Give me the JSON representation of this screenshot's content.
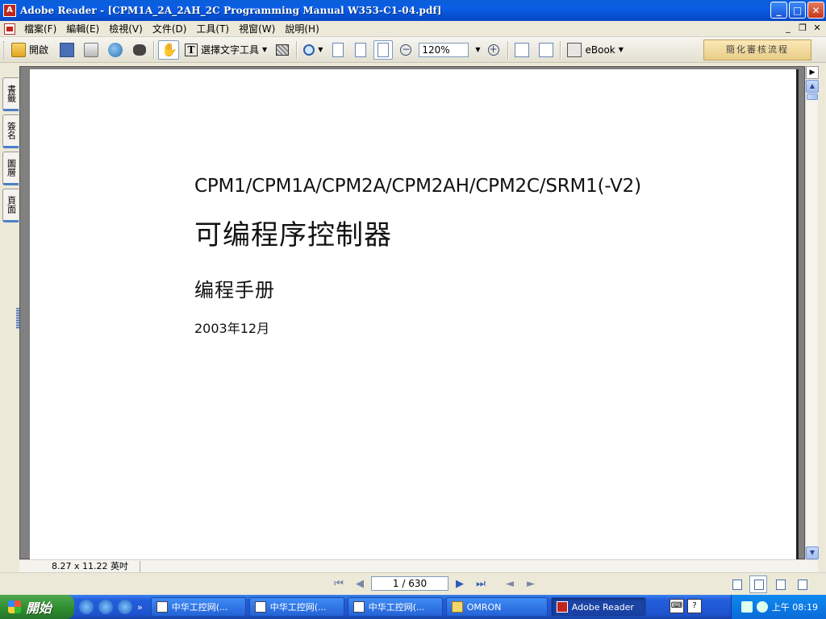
{
  "window": {
    "title": "Adobe Reader - [CPM1A_2A_2AH_2C Programming Manual W353-C1-04.pdf]",
    "app_icon": "pdf-icon"
  },
  "menu": {
    "items": [
      "檔案(F)",
      "編輯(E)",
      "檢視(V)",
      "文件(D)",
      "工具(T)",
      "視窗(W)",
      "說明(H)"
    ]
  },
  "toolbar": {
    "open_label": "開啟",
    "select_text_label": "選擇文字工具",
    "zoom_value": "120%",
    "ebook_label": "eBook",
    "workflow_label": "簡化審核流程"
  },
  "side_tabs": [
    "書籤",
    "簽名",
    "圖層",
    "頁面"
  ],
  "document": {
    "model_line": "CPM1/CPM1A/CPM2A/CPM2AH/CPM2C/SRM1(-V2)",
    "title": "可编程序控制器",
    "subtitle": "编程手册",
    "date": "2003年12月"
  },
  "status": {
    "page_size": "8.27 x 11.22 英吋",
    "page_indicator": "1 / 630"
  },
  "taskbar": {
    "start_label": "開始",
    "tasks": [
      {
        "label": "中华工控网(...",
        "icon": "browser-icon"
      },
      {
        "label": "中华工控网(...",
        "icon": "browser-icon"
      },
      {
        "label": "中华工控网(...",
        "icon": "browser-icon"
      },
      {
        "label": "OMRON",
        "icon": "folder-icon"
      },
      {
        "label": "Adobe Reader",
        "icon": "pdf-icon"
      }
    ],
    "clock": "上午 08:19"
  },
  "colors": {
    "title_bar": "#0b5de6",
    "taskbar": "#245edb",
    "start_button": "#2e8b2e",
    "workflow_button": "#f0d897"
  }
}
